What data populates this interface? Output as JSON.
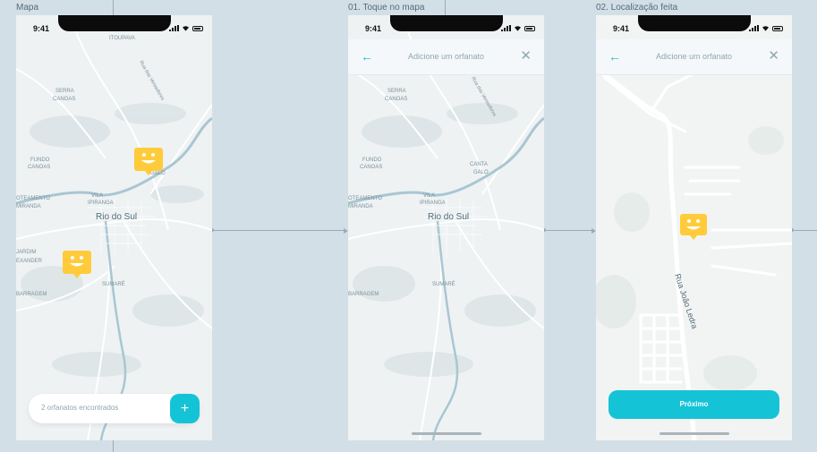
{
  "frames": [
    {
      "title": "Mapa",
      "status_time": "9:41"
    },
    {
      "title": "01. Toque no mapa",
      "status_time": "9:41"
    },
    {
      "title": "02. Localização feita",
      "status_time": "9:41"
    }
  ],
  "map": {
    "place_itoupava": "ITOUPAVA",
    "place_serra_canoas_1": "SERRA",
    "place_serra_canoas_2": "CANOAS",
    "place_fundo_canoas_1": "FUNDO",
    "place_fundo_canoas_2": "CANOAS",
    "place_loteamento_1": "OTEAMENTO",
    "place_loteamento_2": "MIRANDA",
    "place_vila_1": "VILA",
    "place_vila_2": "IPIRANGA",
    "place_canta_1": "CANTA",
    "place_canta_2": "GALO",
    "place_jardim_1": "JARDIM",
    "place_jardim_2": "EXANDER",
    "place_sumare": "SUMARÉ",
    "place_barragem": "BARRAGEM",
    "city": "Rio do Sul",
    "road_vereadores": "Rua dos Vereadores",
    "street_joao_ledra": "Rua João Ledra"
  },
  "screen1": {
    "found_count": "2 orfanatos encontrados",
    "add_label": "+"
  },
  "screen2": {
    "header_title": "Adicione um orfanato",
    "back_icon": "←",
    "close_icon": "✕"
  },
  "screen3": {
    "header_title": "Adicione um orfanato",
    "back_icon": "←",
    "close_icon": "✕",
    "next_label": "Próximo"
  },
  "colors": {
    "accent": "#15c3d6",
    "marker": "#ffcb3a",
    "background": "#d3dfe7",
    "river": "#a9c6d2"
  }
}
